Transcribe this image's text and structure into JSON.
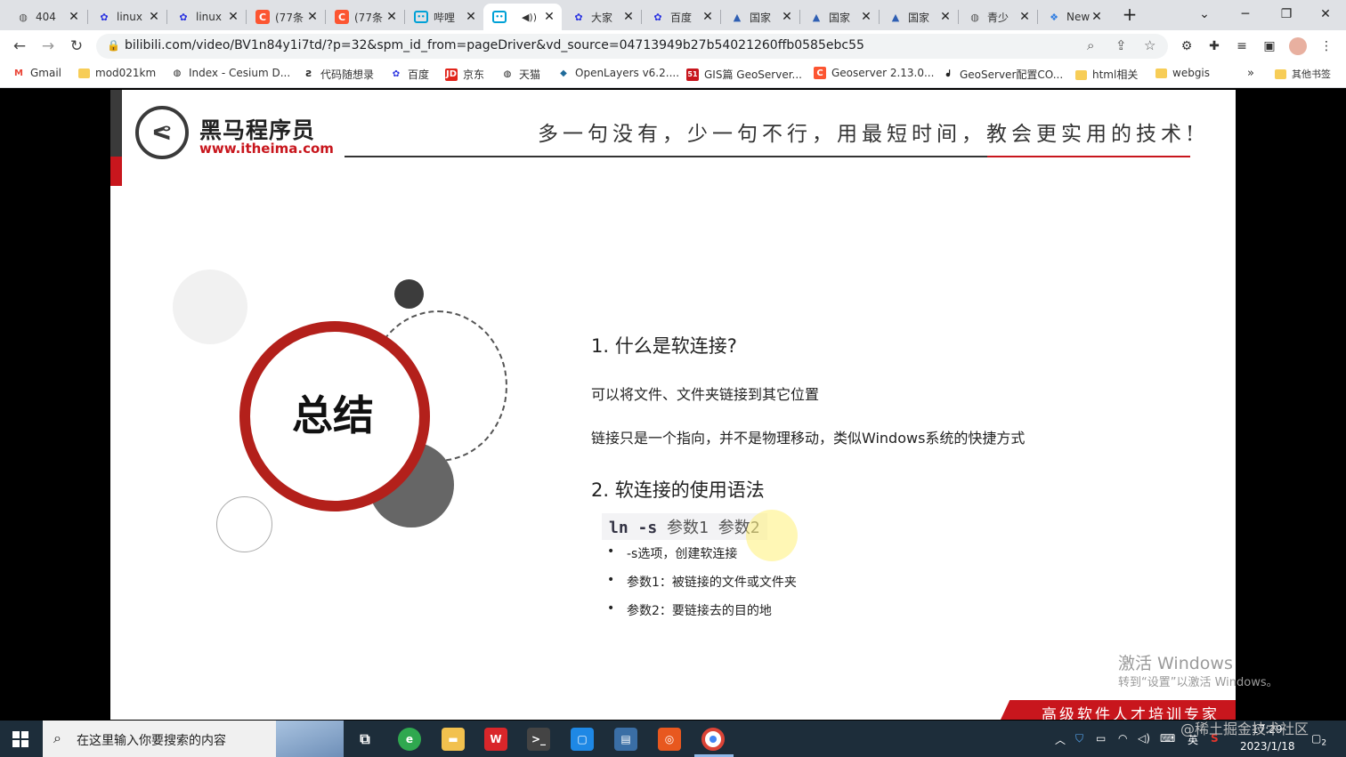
{
  "tabs": [
    {
      "label": "404",
      "icon": "globe-icon",
      "active": false
    },
    {
      "label": "linux",
      "icon": "baidu-paw-icon",
      "active": false
    },
    {
      "label": "linux",
      "icon": "baidu-paw-icon",
      "active": false
    },
    {
      "label": "(77条",
      "icon": "csdn-icon",
      "active": false
    },
    {
      "label": "(77条",
      "icon": "csdn-icon",
      "active": false
    },
    {
      "label": "哔哩",
      "icon": "bilibili-icon",
      "active": false
    },
    {
      "label": "",
      "icon": "bilibili-icon",
      "active": true,
      "audio": true
    },
    {
      "label": "大家",
      "icon": "baidu-paw-icon",
      "active": false
    },
    {
      "label": "百度",
      "icon": "baidu-paw-icon",
      "active": false
    },
    {
      "label": "国家",
      "icon": "edu-cap-icon",
      "active": false
    },
    {
      "label": "国家",
      "icon": "edu-cap-icon",
      "active": false
    },
    {
      "label": "国家",
      "icon": "edu-cap-icon",
      "active": false
    },
    {
      "label": "青少",
      "icon": "globe-icon",
      "active": false
    },
    {
      "label": "New",
      "icon": "new-tab-icon",
      "active": false
    }
  ],
  "address_bar": {
    "url": "bilibili.com/video/BV1n84y1i7td/?p=32&spm_id_from=pageDriver&vd_source=04713949b27b54021260ffb0585ebc55"
  },
  "bookmarks": [
    {
      "label": "Gmail",
      "icon": "gmail-icon"
    },
    {
      "label": "mod021km",
      "icon": "folder-icon"
    },
    {
      "label": "Index - Cesium D...",
      "icon": "globe-icon"
    },
    {
      "label": "代码随想录",
      "icon": "code-icon"
    },
    {
      "label": "百度",
      "icon": "baidu-paw-icon"
    },
    {
      "label": "京东",
      "icon": "jd-icon"
    },
    {
      "label": "天猫",
      "icon": "globe-icon"
    },
    {
      "label": "OpenLayers v6.2....",
      "icon": "openlayers-icon"
    },
    {
      "label": "GIS篇 GeoServer...",
      "icon": "51cto-icon"
    },
    {
      "label": "Geoserver 2.13.0...",
      "icon": "csdn-icon"
    },
    {
      "label": "GeoServer配置CO...",
      "icon": "geoserver-icon"
    },
    {
      "label": "html相关",
      "icon": "folder-icon"
    },
    {
      "label": "webgis",
      "icon": "folder-icon"
    },
    {
      "label": "其他书签",
      "icon": "folder-icon"
    }
  ],
  "slide": {
    "logo_cn": "黑马程序员",
    "logo_url": "www.itheima.com",
    "slogan": "多一句没有，少一句不行，用最短时间，教会更实用的技术!",
    "summary_label": "总结",
    "q1": "1. 什么是软连接?",
    "q1_p1": "可以将文件、文件夹链接到其它位置",
    "q1_p2": "链接只是一个指向，并不是物理移动，类似Windows系统的快捷方式",
    "q2": "2. 软连接的使用语法",
    "code_cmd": "ln -s",
    "code_args": "参数1  参数2",
    "bullets": [
      "-s选项，创建软连接",
      "参数1：被链接的文件或文件夹",
      "参数2：要链接去的目的地"
    ],
    "footer": "高级软件人才培训专家"
  },
  "windows_activation": {
    "line1": "激活 Windows",
    "line2": "转到“设置”以激活 Windows。"
  },
  "watermark": "@稀土掘金技术社区",
  "taskbar": {
    "search_placeholder": "在这里输入你要搜索的内容",
    "ime": "英",
    "time": "17:29",
    "date": "2023/1/18",
    "notification_count": "2"
  },
  "colors": {
    "accent_red": "#c8161d",
    "tab_strip": "#dfe1e5",
    "taskbar": "#1d2d3a"
  }
}
